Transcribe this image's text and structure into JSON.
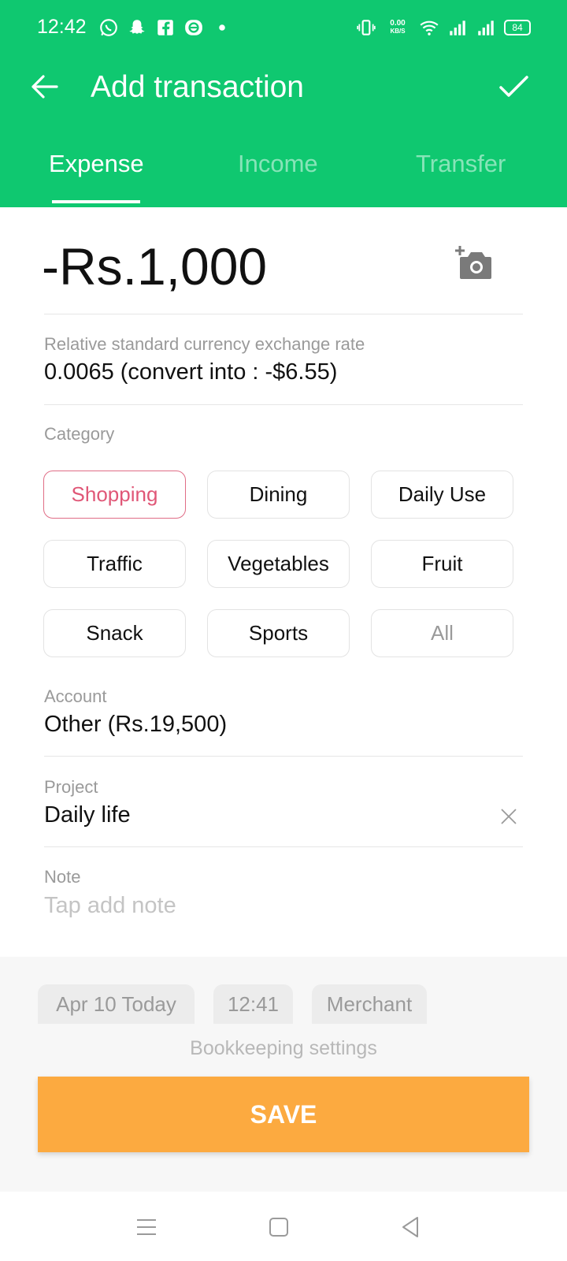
{
  "status_bar": {
    "time": "12:42",
    "net_speed_value": "0.00",
    "net_speed_unit": "KB/S",
    "battery": "84",
    "left_icons": [
      "whatsapp-icon",
      "snapchat-icon",
      "facebook-icon",
      "app-icon",
      "dot-icon"
    ],
    "right_icons": [
      "vibrate-icon",
      "wifi-icon",
      "signal-icon",
      "signal-icon"
    ]
  },
  "header": {
    "title": "Add transaction",
    "back_icon": "arrow-left-icon",
    "confirm_icon": "check-icon"
  },
  "tabs": [
    {
      "label": "Expense",
      "active": true
    },
    {
      "label": "Income",
      "active": false
    },
    {
      "label": "Transfer",
      "active": false
    }
  ],
  "amount": "-Rs.1,000",
  "exchange": {
    "label": "Relative standard currency exchange rate",
    "value": "0.0065 (convert into : -$6.55)"
  },
  "category": {
    "label": "Category",
    "items": [
      {
        "label": "Shopping",
        "selected": true
      },
      {
        "label": "Dining",
        "selected": false
      },
      {
        "label": "Daily Use",
        "selected": false
      },
      {
        "label": "Traffic",
        "selected": false
      },
      {
        "label": "Vegetables",
        "selected": false
      },
      {
        "label": "Fruit",
        "selected": false
      },
      {
        "label": "Snack",
        "selected": false
      },
      {
        "label": "Sports",
        "selected": false
      },
      {
        "label": "All",
        "selected": false
      }
    ]
  },
  "account": {
    "label": "Account",
    "value": "Other (Rs.19,500)"
  },
  "project": {
    "label": "Project",
    "value": "Daily life"
  },
  "note": {
    "label": "Note",
    "placeholder": "Tap add note"
  },
  "meta_pills": {
    "date": "Apr 10  Today",
    "time": "12:41",
    "merchant": "Merchant"
  },
  "bookkeeping_settings": "Bookkeeping settings",
  "save_label": "SAVE",
  "colors": {
    "header_green": "#0fc870",
    "selected_chip": "#e05777",
    "save_orange": "#fcaa40"
  }
}
